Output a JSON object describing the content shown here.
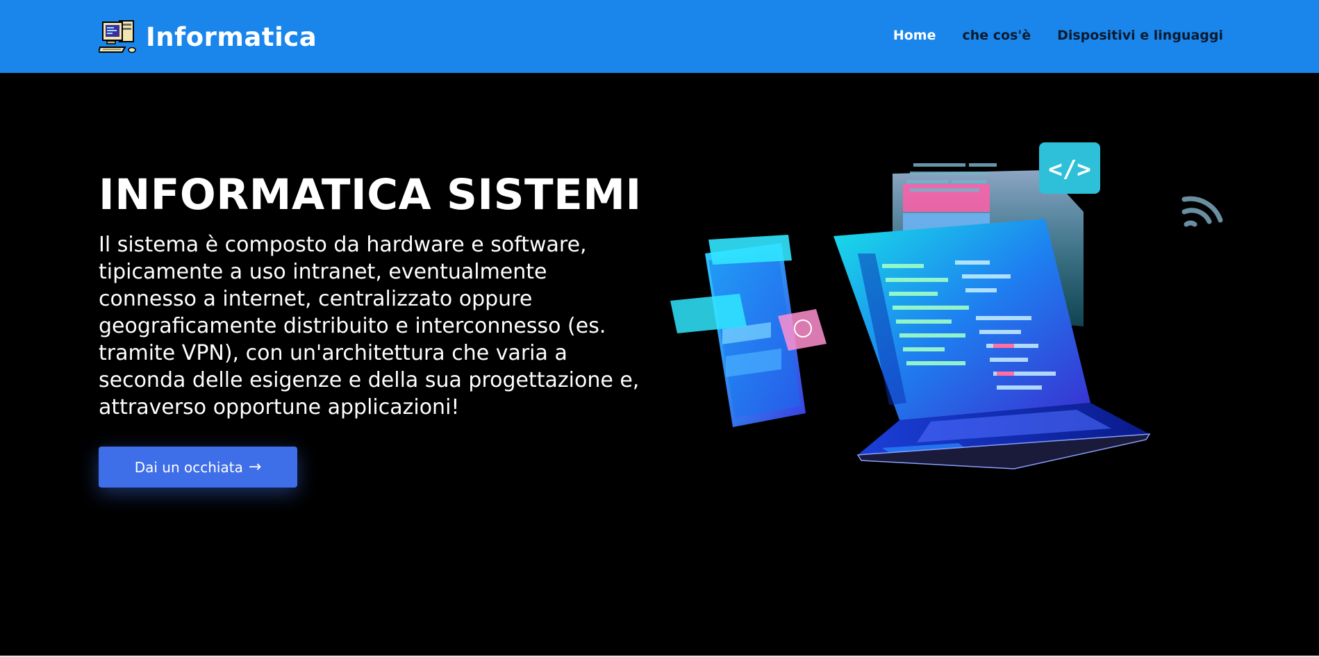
{
  "brand": {
    "name": "Informatica",
    "icon": "computer-icon"
  },
  "nav": {
    "items": [
      {
        "label": "Home",
        "active": true
      },
      {
        "label": "che cos'è",
        "active": false
      },
      {
        "label": "Dispositivi e linguaggi",
        "active": false
      }
    ]
  },
  "hero": {
    "title": "INFORMATICA SISTEMI",
    "text": "Il sistema è composto da hardware e software, tipicamente a uso intranet, eventualmente connesso a internet, centralizzato oppure geograficamente distribuito e interconnesso (es. tramite VPN), con un'architettura che varia a seconda delle esigenze e della sua progettazione e, attraverso opportune applicazioni!",
    "cta_label": "Dai un occhiata",
    "cta_icon": "arrow-right-icon",
    "illustration": "laptop-code-illustration"
  },
  "colors": {
    "navbar": "#1a86eb",
    "cta": "#3f6fe8",
    "background": "#000000"
  }
}
